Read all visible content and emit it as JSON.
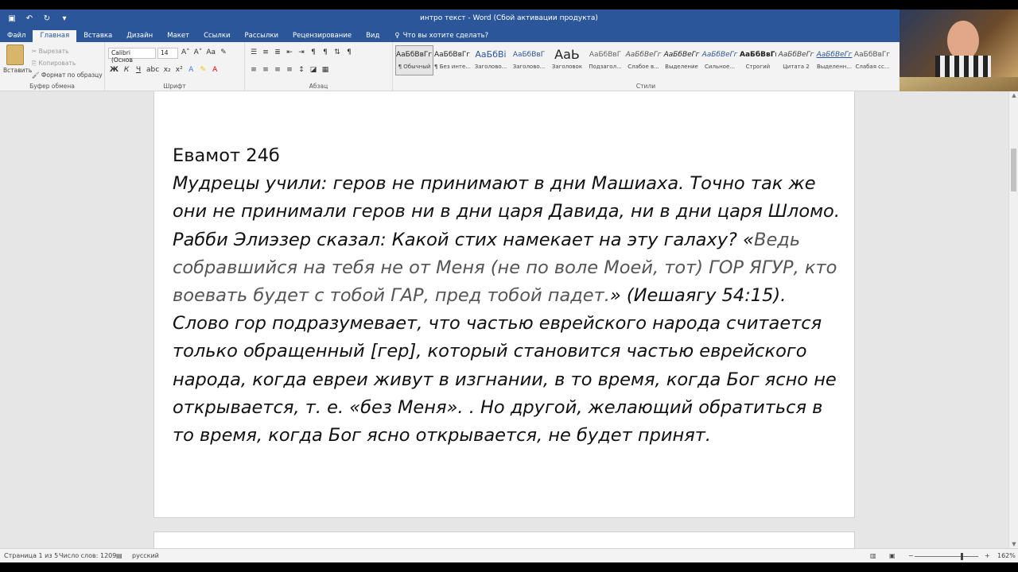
{
  "window": {
    "title": "интро текст - Word (Сбой активации продукта)"
  },
  "qat": {
    "save_icon": "save-icon",
    "undo_icon": "undo-icon",
    "redo_icon": "redo-icon"
  },
  "tabs": [
    {
      "label": "Файл"
    },
    {
      "label": "Главная"
    },
    {
      "label": "Вставка"
    },
    {
      "label": "Дизайн"
    },
    {
      "label": "Макет"
    },
    {
      "label": "Ссылки"
    },
    {
      "label": "Рассылки"
    },
    {
      "label": "Рецензирование"
    },
    {
      "label": "Вид"
    }
  ],
  "tell_me": "Что вы хотите сделать?",
  "clipboard": {
    "paste": "Вставить",
    "cut": "Вырезать",
    "copy": "Копировать",
    "format_painter": "Формат по образцу",
    "group": "Буфер обмена"
  },
  "font": {
    "name": "Calibri (Основ",
    "size": "14",
    "group": "Шрифт"
  },
  "paragraph": {
    "group": "Абзац"
  },
  "styles": {
    "group": "Стили",
    "items": [
      {
        "preview": "АаБбВвГг,",
        "name": "¶ Обычный"
      },
      {
        "preview": "АаБбВвГг,",
        "name": "¶ Без инте..."
      },
      {
        "preview": "АаБбВі",
        "name": "Заголово..."
      },
      {
        "preview": "АаБбВвГ",
        "name": "Заголово..."
      },
      {
        "preview": "АаЬ",
        "name": "Заголовок"
      },
      {
        "preview": "АаБбВвГ",
        "name": "Подзагол..."
      },
      {
        "preview": "АаБбВеГг",
        "name": "Слабое в..."
      },
      {
        "preview": "АаБбВеГг",
        "name": "Выделение"
      },
      {
        "preview": "АаБбВеГг",
        "name": "Сильное..."
      },
      {
        "preview": "АаБбВвГг,",
        "name": "Строгий"
      },
      {
        "preview": "АаБбВеГг",
        "name": "Цитата 2"
      },
      {
        "preview": "АаБбВеГг",
        "name": "Выделенн..."
      },
      {
        "preview": "АаБбВвГг,",
        "name": "Слабая сс..."
      }
    ]
  },
  "document": {
    "heading": "Евамот 24б",
    "p1": "Мудрецы учили: геров не принимают в дни Машиаха. Точно так же они не принимали геров ни в дни царя Давида, ни в дни царя Шломо. Рабби Элиэзер сказал: Какой стих намекает на эту галаху? «",
    "quote": "Ведь собравшийся на тебя не от Меня (не по воле Моей, тот) ГОР ЯГУР, кто воевать будет с тобой ГАР, пред тобой падет.",
    "p2": "» (Иешаягу 54:15). Слово гор подразумевает, что частью еврейского народа считается только обращенный [гер], который становится частью еврейского народа, когда евреи живут в изгнании, в то время, когда Бог ясно не открывается, т. е. «без Меня». . Но другой, желающий обратиться в то время, когда Бог ясно открывается, не будет принят."
  },
  "status": {
    "page": "Страница 1 из 5",
    "words": "Число слов: 1209",
    "language": "русский",
    "zoom": "162%"
  }
}
